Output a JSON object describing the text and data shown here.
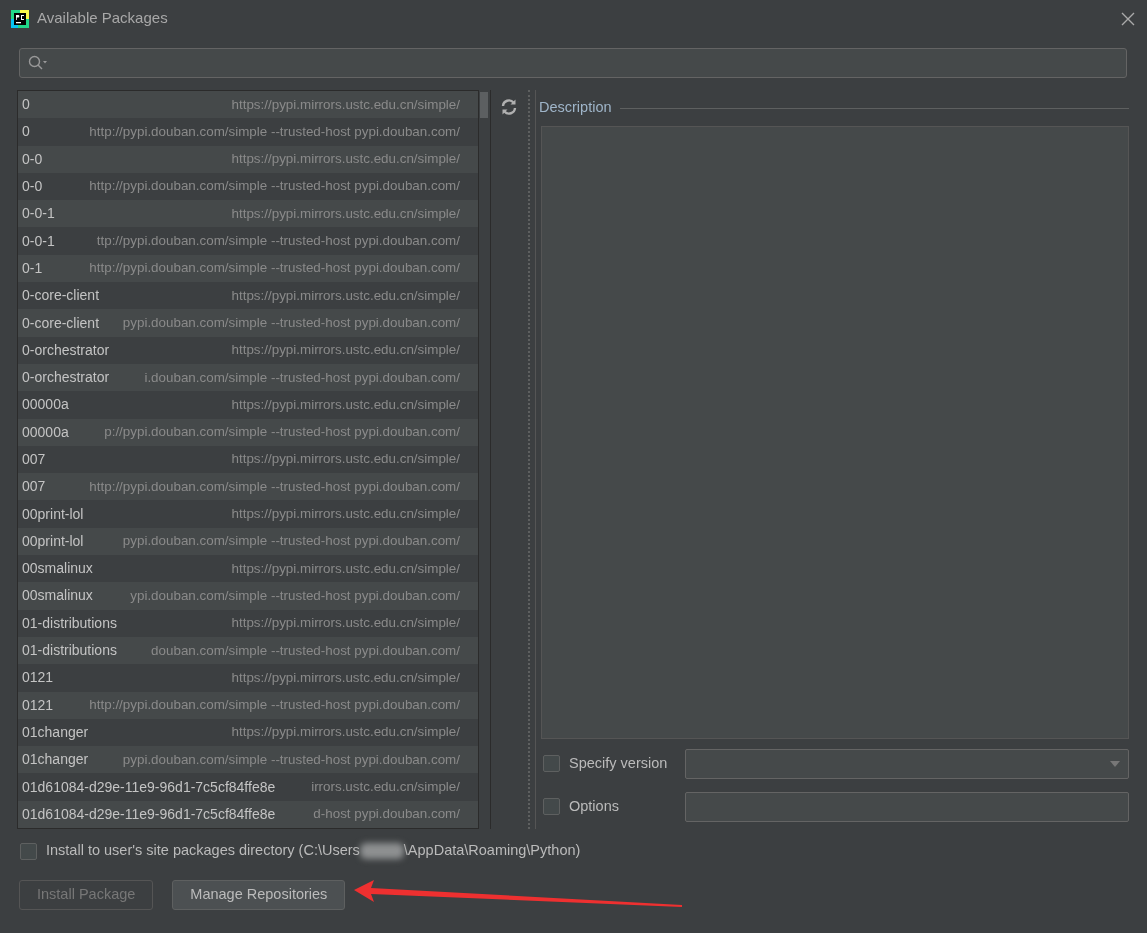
{
  "window": {
    "title": "Available Packages"
  },
  "packages": [
    {
      "name": "0",
      "repository": "https://pypi.mirrors.ustc.edu.cn/simple/"
    },
    {
      "name": "0",
      "repository": "http://pypi.douban.com/simple --trusted-host pypi.douban.com/"
    },
    {
      "name": "0-0",
      "repository": "https://pypi.mirrors.ustc.edu.cn/simple/"
    },
    {
      "name": "0-0",
      "repository": "http://pypi.douban.com/simple --trusted-host pypi.douban.com/"
    },
    {
      "name": "0-0-1",
      "repository": "https://pypi.mirrors.ustc.edu.cn/simple/"
    },
    {
      "name": "0-0-1",
      "repository": "ttp://pypi.douban.com/simple --trusted-host pypi.douban.com/"
    },
    {
      "name": "0-1",
      "repository": "http://pypi.douban.com/simple --trusted-host pypi.douban.com/"
    },
    {
      "name": "0-core-client",
      "repository": "https://pypi.mirrors.ustc.edu.cn/simple/"
    },
    {
      "name": "0-core-client",
      "repository": "pypi.douban.com/simple --trusted-host pypi.douban.com/"
    },
    {
      "name": "0-orchestrator",
      "repository": "https://pypi.mirrors.ustc.edu.cn/simple/"
    },
    {
      "name": "0-orchestrator",
      "repository": "i.douban.com/simple --trusted-host pypi.douban.com/"
    },
    {
      "name": "00000a",
      "repository": "https://pypi.mirrors.ustc.edu.cn/simple/"
    },
    {
      "name": "00000a",
      "repository": "p://pypi.douban.com/simple --trusted-host pypi.douban.com/"
    },
    {
      "name": "007",
      "repository": "https://pypi.mirrors.ustc.edu.cn/simple/"
    },
    {
      "name": "007",
      "repository": "http://pypi.douban.com/simple --trusted-host pypi.douban.com/"
    },
    {
      "name": "00print-lol",
      "repository": "https://pypi.mirrors.ustc.edu.cn/simple/"
    },
    {
      "name": "00print-lol",
      "repository": "pypi.douban.com/simple --trusted-host pypi.douban.com/"
    },
    {
      "name": "00smalinux",
      "repository": "https://pypi.mirrors.ustc.edu.cn/simple/"
    },
    {
      "name": "00smalinux",
      "repository": "ypi.douban.com/simple --trusted-host pypi.douban.com/"
    },
    {
      "name": "01-distributions",
      "repository": "https://pypi.mirrors.ustc.edu.cn/simple/"
    },
    {
      "name": "01-distributions",
      "repository": "douban.com/simple --trusted-host pypi.douban.com/"
    },
    {
      "name": "0121",
      "repository": "https://pypi.mirrors.ustc.edu.cn/simple/"
    },
    {
      "name": "0121",
      "repository": "http://pypi.douban.com/simple --trusted-host pypi.douban.com/"
    },
    {
      "name": "01changer",
      "repository": "https://pypi.mirrors.ustc.edu.cn/simple/"
    },
    {
      "name": "01changer",
      "repository": "pypi.douban.com/simple --trusted-host pypi.douban.com/"
    },
    {
      "name": "01d61084-d29e-11e9-96d1-7c5cf84ffe8e",
      "repository": "irrors.ustc.edu.cn/simple/"
    },
    {
      "name": "01d61084-d29e-11e9-96d1-7c5cf84ffe8e",
      "repository": "d-host pypi.douban.com/"
    }
  ],
  "description": {
    "label": "Description"
  },
  "specify_version": {
    "label": "Specify version",
    "checked": false
  },
  "options": {
    "label": "Options",
    "checked": false
  },
  "user_site": {
    "label_before": "Install to user's site packages directory (C:\\Users",
    "label_after": "\\AppData\\Roaming\\Python)",
    "checked": false
  },
  "buttons": [
    {
      "label": "Install Package",
      "disabled": true
    },
    {
      "label": "Manage Repositories",
      "disabled": false
    }
  ],
  "annotation": {
    "kind": "arrow"
  }
}
